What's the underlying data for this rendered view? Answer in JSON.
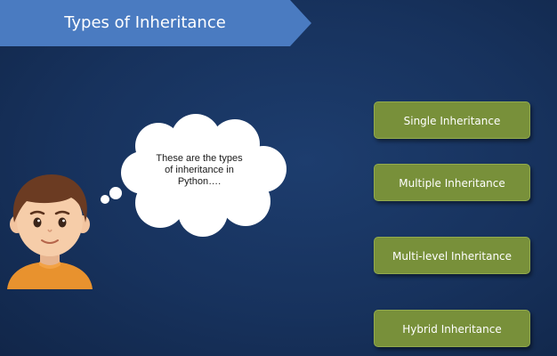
{
  "slide": {
    "title": "Types of Inheritance",
    "thought_bubble": {
      "lines": [
        "These are the types",
        "of inheritance in",
        "Python…."
      ]
    },
    "inheritance_types": [
      {
        "label": "Single Inheritance"
      },
      {
        "label": "Multiple Inheritance"
      },
      {
        "label": "Multi-level Inheritance"
      },
      {
        "label": "Hybrid Inheritance"
      }
    ]
  },
  "colors": {
    "background": "#17325d",
    "title_banner": "#4a7bc1",
    "box_fill": "#78903a",
    "box_border": "#93ab4d",
    "bubble_fill": "#ffffff"
  },
  "icons": {
    "avatar": "boy-avatar-icon"
  }
}
